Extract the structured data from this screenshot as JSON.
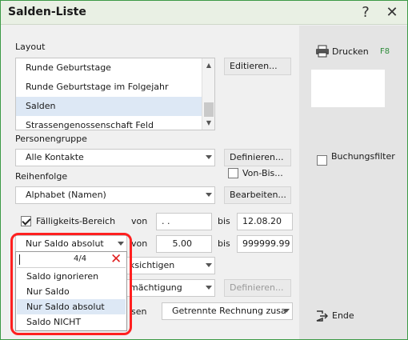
{
  "window": {
    "title": "Salden-Liste",
    "help_glyph": "?",
    "close_glyph": "✕"
  },
  "layout": {
    "label": "Layout",
    "items": [
      "Runde Geburtstage",
      "Runde Geburtstage im Folgejahr",
      "Salden",
      "Strassengenossenschaft Feld"
    ],
    "selected": "Salden",
    "edit_button": "Editieren..."
  },
  "personengruppe": {
    "label": "Personengruppe",
    "value": "Alle Kontakte",
    "define_button": "Definieren...",
    "von_bis_label": "Von-Bis..."
  },
  "reihenfolge": {
    "label": "Reihenfolge",
    "value": "Alphabet (Namen)",
    "edit_button": "Bearbeiten..."
  },
  "faelligkeit": {
    "label": "Fälligkeits-Bereich",
    "checked": true,
    "von_label": "von",
    "von_value": " .  . ",
    "bis_label": "bis",
    "bis_value": "12.08.20"
  },
  "saldo": {
    "combo_value": "Nur Saldo absolut",
    "von_label": "von",
    "von_value": "5.00",
    "bis_label": "bis",
    "bis_value": "999999.99"
  },
  "hidden_row_1": {
    "combo_value_partial": "ksichtigen"
  },
  "hidden_row_2": {
    "combo_value_partial": "mächtigung",
    "define_button": "Definieren..."
  },
  "hidden_row_3": {
    "label_partial": "sen",
    "combo_value": "Getrennte Rechnung zusa"
  },
  "dropdown": {
    "search_value": "",
    "count": "4/4",
    "clear_glyph": "✕",
    "options": [
      "Saldo ignorieren",
      "Nur Saldo",
      "Nur Saldo absolut",
      "Saldo NICHT"
    ],
    "selected": "Nur Saldo absolut"
  },
  "side": {
    "print_label": "Drucken",
    "print_shortcut": "F8",
    "buchungsfilter_label": "Buchungsfilter",
    "ende_label": "Ende"
  },
  "colors": {
    "accent_green": "#3c9a46",
    "highlight_red": "#ff2020",
    "selection": "#dde8f5"
  }
}
